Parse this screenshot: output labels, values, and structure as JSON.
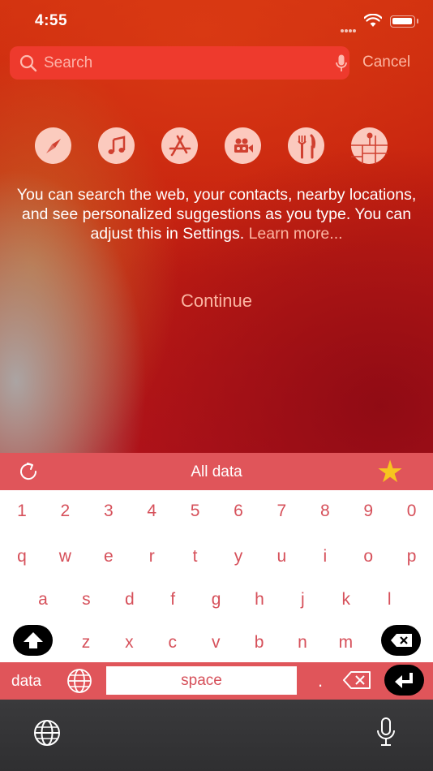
{
  "status_bar": {
    "time": "4:55"
  },
  "search": {
    "placeholder": "Search",
    "cancel_label": "Cancel"
  },
  "categories": [
    "safari-icon",
    "music-icon",
    "app-store-icon",
    "camera-icon",
    "restaurant-icon",
    "map-icon"
  ],
  "intro": {
    "text": "You can search the web, your contacts, nearby locations, and see personalized suggestions as you type. You can adjust this in Settings.",
    "learn_more": "Learn more..."
  },
  "continue_label": "Continue",
  "keyboard": {
    "toolbar_title": "All data",
    "rows": [
      [
        "1",
        "2",
        "3",
        "4",
        "5",
        "6",
        "7",
        "8",
        "9",
        "0"
      ],
      [
        "q",
        "w",
        "e",
        "r",
        "t",
        "y",
        "u",
        "i",
        "o",
        "p"
      ],
      [
        "a",
        "s",
        "d",
        "f",
        "g",
        "h",
        "j",
        "k",
        "l"
      ],
      [
        "z",
        "x",
        "c",
        "v",
        "b",
        "n",
        "m"
      ]
    ],
    "data_label": "data",
    "space_label": "space",
    "period_label": "."
  },
  "colors": {
    "accent": "#e0555a",
    "key_text": "#d6505a",
    "star": "#f7c51f",
    "background_red": "#c4200f"
  }
}
